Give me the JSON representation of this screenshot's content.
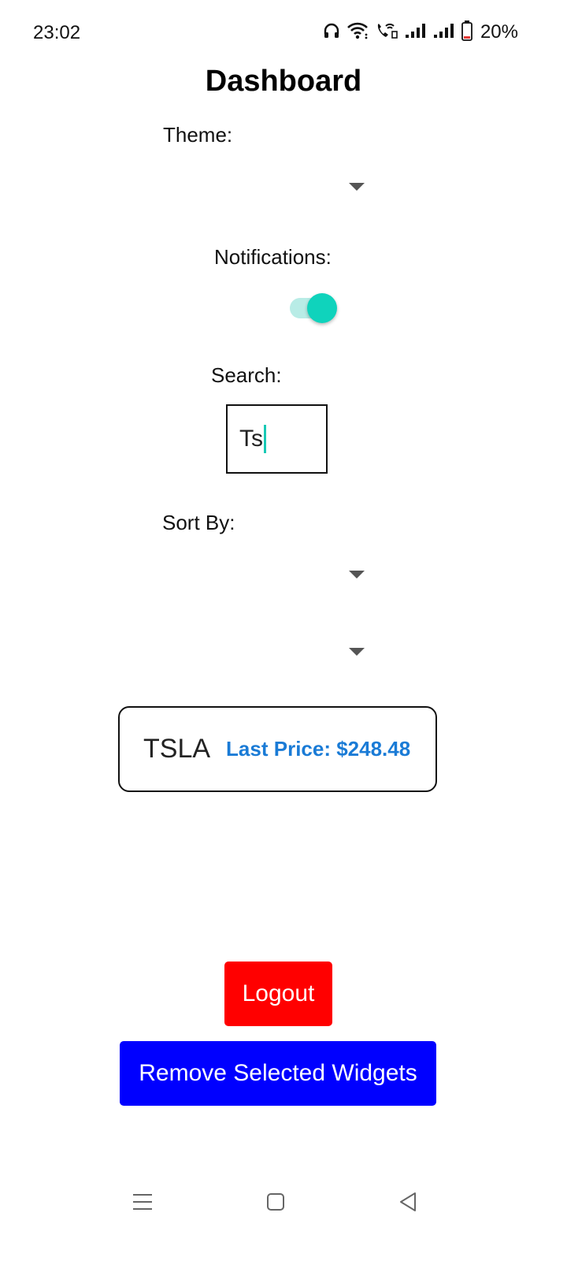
{
  "status_bar": {
    "time": "23:02",
    "battery": "20%",
    "icons": [
      "headphones-icon",
      "wifi-icon",
      "wifi-calling-icon",
      "signal-icon",
      "signal-icon",
      "battery-icon"
    ]
  },
  "page": {
    "title": "Dashboard"
  },
  "theme": {
    "label": "Theme:",
    "selected": ""
  },
  "notifications": {
    "label": "Notifications:",
    "enabled": true
  },
  "search": {
    "label": "Search:",
    "value": "Ts"
  },
  "sort": {
    "label": "Sort By:",
    "selected": "",
    "secondary_selected": ""
  },
  "stock_card": {
    "symbol": "TSLA",
    "last_price_label": "Last Price: $248.48"
  },
  "buttons": {
    "logout": "Logout",
    "remove_widgets": "Remove Selected Widgets"
  },
  "nav_bar": {
    "items": [
      "menu-icon",
      "home-icon",
      "back-icon"
    ]
  },
  "colors": {
    "accent": "#0fd3bc",
    "price": "#1a7bd6",
    "logout": "#ff0000",
    "remove": "#0000ff"
  }
}
